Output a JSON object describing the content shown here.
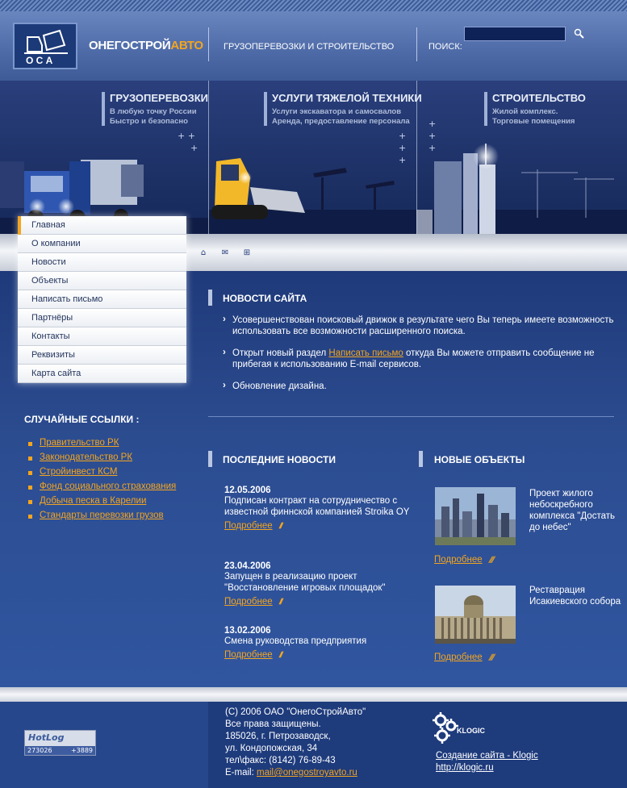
{
  "header": {
    "brand_main": "ОНЕГОСТРОЙ",
    "brand_accent": "АВТО",
    "tagline": "ГРУЗОПЕРЕВОЗКИ И СТРОИТЕЛЬСТВО",
    "search_label": "ПОИСК:",
    "search_value": "",
    "logo_text": "О С А"
  },
  "banner": [
    {
      "title": "ГРУЗОПЕРЕВОЗКИ",
      "line1": "В любую точку России",
      "line2": "Быстро и безопасно"
    },
    {
      "title": "УСЛУГИ ТЯЖЕЛОЙ ТЕХНИКИ",
      "line1": "Услуги экскаватора и самосвалов",
      "line2": "Аренда, предоставление персонала"
    },
    {
      "title": "СТРОИТЕЛЬСТВО",
      "line1": "Жилой комплекс.",
      "line2": "Торговые помещения"
    }
  ],
  "menu": [
    "Главная",
    "О компании",
    "Новости",
    "Объекты",
    "Написать письмо",
    "Партнёры",
    "Контакты",
    "Реквизиты",
    "Карта сайта"
  ],
  "quick_icons": [
    "home-icon",
    "mail-icon",
    "sitemap-icon"
  ],
  "random_links": {
    "title": "СЛУЧАЙНЫЕ ССЫЛКИ :",
    "items": [
      "Правительство РК",
      "Законодательство РК",
      "Стройинвест КСМ",
      "Фонд социального страхования",
      "Добыча песка в Карелии",
      "Стандарты перевозки грузов"
    ]
  },
  "site_news": {
    "title": "НОВОСТИ САЙТА",
    "item1": "Усовершенствован поисковый движок в результате чего Вы теперь имеете возможность использовать все возможности расширенного поиска.",
    "item2_before": "Открыт новый раздел ",
    "item2_link": "Написать письмо",
    "item2_after": " откуда Вы можете отправить сообщение не прибегая к использованию E-mail сервисов.",
    "item3": "Обновление дизайна."
  },
  "latest_news": {
    "title": "ПОСЛЕДНИЕ НОВОСТИ",
    "more_label": "Подробнее",
    "items": [
      {
        "date": "12.05.2006",
        "text": "Подписан контракт на сотрудничество с известной финнской компанией Stroika OY"
      },
      {
        "date": "23.04.2006",
        "text": "Запущен в реализацию проект \"Восстановление игровых площадок\""
      },
      {
        "date": "13.02.2006",
        "text": "Смена руководства предприятия"
      }
    ]
  },
  "new_objects": {
    "title": "НОВЫЕ ОБЪЕКТЫ",
    "more_label": "Подробнее",
    "items": [
      {
        "text": "Проект жилого небоскребного комплекса \"Достать до небес\""
      },
      {
        "text": "Реставрация Исакиевского собора"
      }
    ]
  },
  "footer": {
    "copyright": "(С) 2006 ОАО \"ОнегоСтройАвто\"",
    "rights": "Все права защищены.",
    "city": "185026, г. Петрозаводск,",
    "street": "ул. Кондопожская, 34",
    "phone": "тел\\факс: (8142) 76-89-43",
    "email_label": "E-mail: ",
    "email": "mail@onegostroyavto.ru",
    "counter_logo": "HotLog",
    "counter_left": "273026",
    "counter_right": "+3889",
    "dev_name": "KLOGIC",
    "dev_link": "Создание сайта - Klogic",
    "dev_url": "http://klogic.ru"
  },
  "colors": {
    "accent": "#f3a51f",
    "background": "#2c4a8a"
  }
}
